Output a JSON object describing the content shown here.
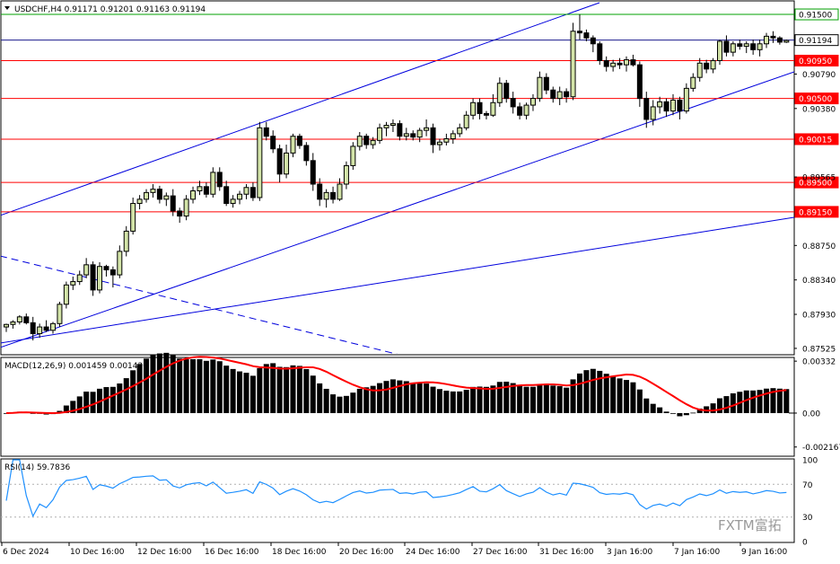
{
  "header": {
    "symbol_info": "USDCHF,H4  0.91171 0.91201 0.91163 0.91194"
  },
  "watermark": {
    "text": "FXTM富拓"
  },
  "colors": {
    "bull_fill": "#d3e4a8",
    "candle_outline": "#000000",
    "channel_line": "#0000dd",
    "level_line": "#ff0000",
    "level_tag": "#ff0000",
    "resistance_line": "#00a000",
    "current_line": "#1a1a8c",
    "macd_bar": "#000000",
    "macd_signal": "#ff0000",
    "rsi_line": "#1e90ff"
  },
  "chart_data": [
    {
      "type": "candlestick",
      "name": "price",
      "y_axis_ticks": [
        "0.87525",
        "0.87930",
        "0.88340",
        "0.88750",
        "0.89565",
        "0.90380",
        "0.90790"
      ],
      "ylim": [
        0.8746,
        0.9165
      ],
      "horizontal_levels": [
        {
          "value": 0.915,
          "label": "0.91500",
          "role": "resistance"
        },
        {
          "value": 0.9095,
          "label": "0.90950",
          "role": "level"
        },
        {
          "value": 0.905,
          "label": "0.90500",
          "role": "level"
        },
        {
          "value": 0.90015,
          "label": "0.90015",
          "role": "level"
        },
        {
          "value": 0.895,
          "label": "0.89500",
          "role": "level"
        },
        {
          "value": 0.8915,
          "label": "0.89150",
          "role": "level"
        }
      ],
      "current_price": {
        "value": 0.91194,
        "label": "0.91194"
      },
      "candles": [
        [
          0.8778,
          0.8782,
          0.8772,
          0.8781
        ],
        [
          0.8781,
          0.8786,
          0.8776,
          0.8784
        ],
        [
          0.8784,
          0.8792,
          0.8781,
          0.879
        ],
        [
          0.879,
          0.8794,
          0.8781,
          0.8783
        ],
        [
          0.8783,
          0.879,
          0.8762,
          0.877
        ],
        [
          0.877,
          0.8782,
          0.8765,
          0.8778
        ],
        [
          0.8778,
          0.8786,
          0.8772,
          0.8774
        ],
        [
          0.8774,
          0.8784,
          0.877,
          0.8782
        ],
        [
          0.8782,
          0.8808,
          0.8778,
          0.8805
        ],
        [
          0.8805,
          0.8832,
          0.88,
          0.8828
        ],
        [
          0.8828,
          0.8838,
          0.8822,
          0.8832
        ],
        [
          0.8832,
          0.8845,
          0.8828,
          0.884
        ],
        [
          0.884,
          0.886,
          0.8836,
          0.8852
        ],
        [
          0.8852,
          0.8856,
          0.8815,
          0.8822
        ],
        [
          0.8822,
          0.8855,
          0.8818,
          0.885
        ],
        [
          0.885,
          0.8852,
          0.8838,
          0.8846
        ],
        [
          0.8846,
          0.885,
          0.8825,
          0.884
        ],
        [
          0.884,
          0.8875,
          0.8836,
          0.8868
        ],
        [
          0.8868,
          0.8898,
          0.8862,
          0.8892
        ],
        [
          0.8892,
          0.8932,
          0.8888,
          0.8925
        ],
        [
          0.8925,
          0.8935,
          0.8918,
          0.893
        ],
        [
          0.893,
          0.8942,
          0.8926,
          0.8938
        ],
        [
          0.8938,
          0.8948,
          0.8932,
          0.8942
        ],
        [
          0.8942,
          0.8946,
          0.8925,
          0.893
        ],
        [
          0.893,
          0.8938,
          0.8922,
          0.8934
        ],
        [
          0.8934,
          0.8942,
          0.891,
          0.8916
        ],
        [
          0.8916,
          0.892,
          0.8902,
          0.891
        ],
        [
          0.891,
          0.8935,
          0.8905,
          0.893
        ],
        [
          0.893,
          0.8945,
          0.8925,
          0.894
        ],
        [
          0.894,
          0.8952,
          0.8935,
          0.8945
        ],
        [
          0.8945,
          0.895,
          0.8932,
          0.8936
        ],
        [
          0.8936,
          0.8968,
          0.8932,
          0.8962
        ],
        [
          0.8962,
          0.8968,
          0.894,
          0.8945
        ],
        [
          0.8945,
          0.8952,
          0.8922,
          0.8925
        ],
        [
          0.8925,
          0.8935,
          0.892,
          0.893
        ],
        [
          0.893,
          0.894,
          0.8924,
          0.8936
        ],
        [
          0.8936,
          0.8948,
          0.893,
          0.8944
        ],
        [
          0.8944,
          0.895,
          0.8928,
          0.8932
        ],
        [
          0.8932,
          0.9022,
          0.8928,
          0.9015
        ],
        [
          0.9015,
          0.9022,
          0.9,
          0.9005
        ],
        [
          0.9005,
          0.9012,
          0.8985,
          0.899
        ],
        [
          0.899,
          0.8995,
          0.895,
          0.896
        ],
        [
          0.896,
          0.8995,
          0.8955,
          0.8985
        ],
        [
          0.8985,
          0.9008,
          0.898,
          0.9005
        ],
        [
          0.9005,
          0.9008,
          0.899,
          0.8994
        ],
        [
          0.8994,
          0.8998,
          0.897,
          0.8976
        ],
        [
          0.8976,
          0.8985,
          0.894,
          0.8948
        ],
        [
          0.8948,
          0.8955,
          0.8922,
          0.893
        ],
        [
          0.893,
          0.8942,
          0.892,
          0.8938
        ],
        [
          0.8938,
          0.8945,
          0.8925,
          0.893
        ],
        [
          0.893,
          0.8955,
          0.8928,
          0.8948
        ],
        [
          0.8948,
          0.8975,
          0.8942,
          0.897
        ],
        [
          0.897,
          0.8998,
          0.8965,
          0.8993
        ],
        [
          0.8993,
          0.901,
          0.8988,
          0.9005
        ],
        [
          0.9005,
          0.9008,
          0.899,
          0.8995
        ],
        [
          0.8995,
          0.9004,
          0.899,
          0.9
        ],
        [
          0.9,
          0.902,
          0.8996,
          0.9015
        ],
        [
          0.9015,
          0.9022,
          0.9005,
          0.9018
        ],
        [
          0.9018,
          0.9025,
          0.901,
          0.902
        ],
        [
          0.902,
          0.9024,
          0.9,
          0.9005
        ],
        [
          0.9005,
          0.9015,
          0.9,
          0.9008
        ],
        [
          0.9008,
          0.9012,
          0.9,
          0.9004
        ],
        [
          0.9004,
          0.9015,
          0.8998,
          0.9012
        ],
        [
          0.9012,
          0.9025,
          0.9005,
          0.9015
        ],
        [
          0.9015,
          0.902,
          0.8985,
          0.8995
        ],
        [
          0.8995,
          0.9002,
          0.8988,
          0.8998
        ],
        [
          0.8998,
          0.9008,
          0.8994,
          0.9002
        ],
        [
          0.9002,
          0.9012,
          0.8996,
          0.9008
        ],
        [
          0.9008,
          0.902,
          0.9004,
          0.9015
        ],
        [
          0.9015,
          0.9035,
          0.9012,
          0.903
        ],
        [
          0.903,
          0.905,
          0.9025,
          0.9045
        ],
        [
          0.9045,
          0.905,
          0.9025,
          0.9032
        ],
        [
          0.9032,
          0.9035,
          0.9025,
          0.903
        ],
        [
          0.903,
          0.9055,
          0.9028,
          0.9045
        ],
        [
          0.9045,
          0.9075,
          0.904,
          0.9068
        ],
        [
          0.9068,
          0.9072,
          0.9045,
          0.905
        ],
        [
          0.905,
          0.9058,
          0.9032,
          0.904
        ],
        [
          0.904,
          0.9045,
          0.9025,
          0.903
        ],
        [
          0.903,
          0.9045,
          0.9025,
          0.9042
        ],
        [
          0.9042,
          0.9055,
          0.9035,
          0.905
        ],
        [
          0.905,
          0.9082,
          0.9046,
          0.9075
        ],
        [
          0.9075,
          0.908,
          0.9055,
          0.906
        ],
        [
          0.906,
          0.9064,
          0.9045,
          0.905
        ],
        [
          0.905,
          0.9064,
          0.9042,
          0.9058
        ],
        [
          0.9058,
          0.9062,
          0.9045,
          0.9052
        ],
        [
          0.9052,
          0.914,
          0.9048,
          0.913
        ],
        [
          0.913,
          0.915,
          0.912,
          0.9128
        ],
        [
          0.9128,
          0.9132,
          0.9118,
          0.9122
        ],
        [
          0.9122,
          0.9125,
          0.9105,
          0.9115
        ],
        [
          0.9115,
          0.9118,
          0.909,
          0.9095
        ],
        [
          0.9095,
          0.91,
          0.9082,
          0.9088
        ],
        [
          0.9088,
          0.9096,
          0.9082,
          0.9092
        ],
        [
          0.9092,
          0.9098,
          0.9085,
          0.909
        ],
        [
          0.909,
          0.91,
          0.9082,
          0.9096
        ],
        [
          0.9096,
          0.9102,
          0.9088,
          0.909
        ],
        [
          0.909,
          0.9094,
          0.904,
          0.905
        ],
        [
          0.905,
          0.9058,
          0.9015,
          0.9025
        ],
        [
          0.9025,
          0.9048,
          0.9018,
          0.904
        ],
        [
          0.904,
          0.9052,
          0.9032,
          0.9046
        ],
        [
          0.9046,
          0.905,
          0.9028,
          0.9035
        ],
        [
          0.9035,
          0.9055,
          0.903,
          0.9048
        ],
        [
          0.9048,
          0.9052,
          0.9025,
          0.9035
        ],
        [
          0.9035,
          0.9068,
          0.9032,
          0.9062
        ],
        [
          0.9062,
          0.908,
          0.9058,
          0.9075
        ],
        [
          0.9075,
          0.9098,
          0.907,
          0.9092
        ],
        [
          0.9092,
          0.9096,
          0.908,
          0.9085
        ],
        [
          0.9085,
          0.9098,
          0.908,
          0.9095
        ],
        [
          0.9095,
          0.912,
          0.909,
          0.9118
        ],
        [
          0.9118,
          0.9125,
          0.91,
          0.9105
        ],
        [
          0.9105,
          0.9118,
          0.91,
          0.9115
        ],
        [
          0.9115,
          0.912,
          0.9108,
          0.9112
        ],
        [
          0.9112,
          0.9118,
          0.9104,
          0.9115
        ],
        [
          0.9115,
          0.912,
          0.9102,
          0.9108
        ],
        [
          0.9108,
          0.912,
          0.91,
          0.9115
        ],
        [
          0.9115,
          0.9128,
          0.911,
          0.9124
        ],
        [
          0.9124,
          0.913,
          0.9116,
          0.9122
        ],
        [
          0.9122,
          0.9124,
          0.9114,
          0.9117
        ],
        [
          0.9117,
          0.912,
          0.9116,
          0.9119
        ]
      ]
    },
    {
      "type": "histogram",
      "name": "MACD",
      "label": "MACD(12,26,9) 0.001459 0.001426",
      "y_axis_ticks": [
        "0.00332",
        "0.00",
        "-0.002167"
      ],
      "ylim": [
        -0.0027,
        0.0035
      ]
    },
    {
      "type": "line",
      "name": "RSI",
      "label": "RSI(14) 59.7836",
      "y_axis_ticks": [
        "100",
        "70",
        "30",
        "0"
      ],
      "ylim": [
        0,
        100
      ]
    }
  ],
  "x_axis": {
    "labels": [
      "6 Dec 2024",
      "10 Dec 16:00",
      "12 Dec 16:00",
      "16 Dec 16:00",
      "18 Dec 16:00",
      "20 Dec 16:00",
      "24 Dec 16:00",
      "27 Dec 16:00",
      "31 Dec 16:00",
      "3 Jan 16:00",
      "7 Jan 16:00",
      "9 Jan 16:00"
    ]
  }
}
